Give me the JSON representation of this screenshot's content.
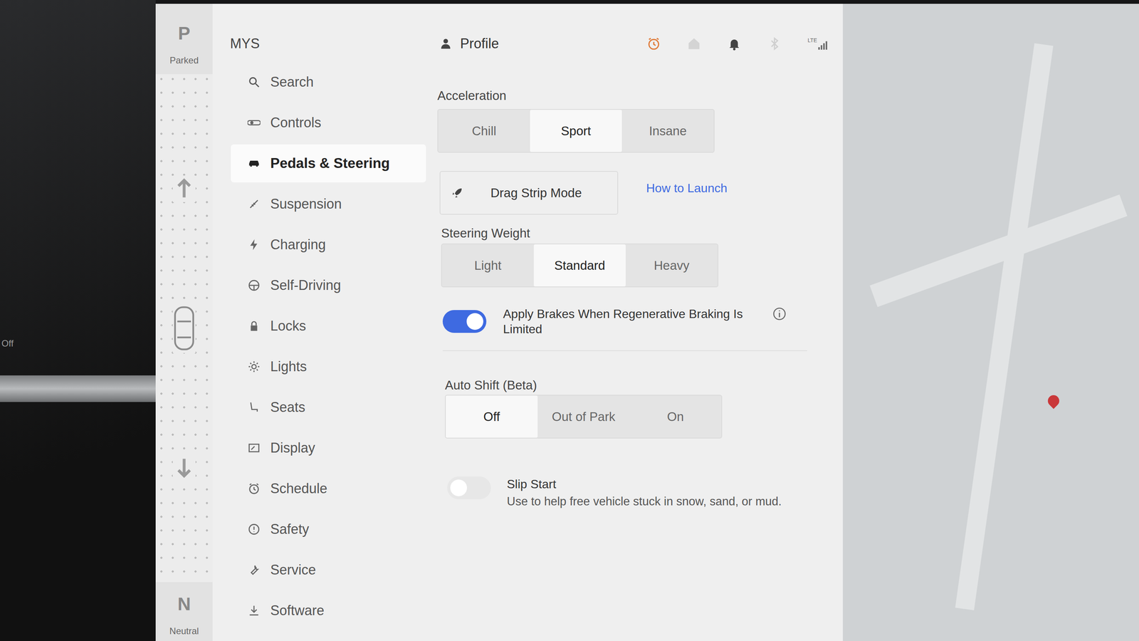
{
  "bezel_text": "Off",
  "gears": [
    {
      "letter": "P",
      "label": "Parked"
    },
    {
      "letter": "N",
      "label": "Neutral"
    }
  ],
  "status": {
    "network": "LTE"
  },
  "sidebar": {
    "title": "MYS",
    "search": "Search",
    "items": [
      {
        "label": "Controls",
        "selected": false
      },
      {
        "label": "Pedals & Steering",
        "selected": true
      },
      {
        "label": "Suspension",
        "selected": false
      },
      {
        "label": "Charging",
        "selected": false
      },
      {
        "label": "Self-Driving",
        "selected": false
      },
      {
        "label": "Locks",
        "selected": false
      },
      {
        "label": "Lights",
        "selected": false
      },
      {
        "label": "Seats",
        "selected": false
      },
      {
        "label": "Display",
        "selected": false
      },
      {
        "label": "Schedule",
        "selected": false
      },
      {
        "label": "Safety",
        "selected": false
      },
      {
        "label": "Service",
        "selected": false
      },
      {
        "label": "Software",
        "selected": false
      }
    ]
  },
  "profile": "Profile",
  "acceleration": {
    "label": "Acceleration",
    "options": [
      {
        "label": "Chill",
        "selected": false
      },
      {
        "label": "Sport",
        "selected": true
      },
      {
        "label": "Insane",
        "selected": false
      }
    ]
  },
  "drag_strip": {
    "label": "Drag Strip Mode",
    "link": "How to Launch"
  },
  "steering_weight": {
    "label": "Steering Weight",
    "options": [
      {
        "label": "Light",
        "selected": false
      },
      {
        "label": "Standard",
        "selected": true
      },
      {
        "label": "Heavy",
        "selected": false
      }
    ]
  },
  "regen_toggle": {
    "label": "Apply Brakes When Regenerative Braking Is Limited",
    "on": true
  },
  "auto_shift": {
    "label": "Auto Shift (Beta)",
    "options": [
      {
        "label": "Off",
        "selected": true
      },
      {
        "label": "Out of Park",
        "selected": false
      },
      {
        "label": "On",
        "selected": false
      }
    ]
  },
  "slip_start": {
    "label": "Slip Start",
    "description": "Use to help free vehicle stuck in snow, sand, or mud.",
    "on": false,
    "disabled": true
  }
}
